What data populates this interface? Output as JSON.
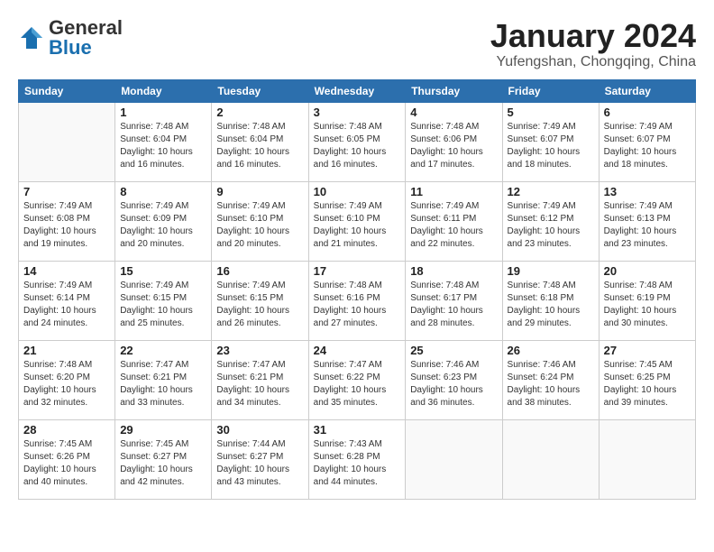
{
  "logo": {
    "general": "General",
    "blue": "Blue"
  },
  "header": {
    "month": "January 2024",
    "location": "Yufengshan, Chongqing, China"
  },
  "weekdays": [
    "Sunday",
    "Monday",
    "Tuesday",
    "Wednesday",
    "Thursday",
    "Friday",
    "Saturday"
  ],
  "weeks": [
    [
      {
        "day": "",
        "info": ""
      },
      {
        "day": "1",
        "info": "Sunrise: 7:48 AM\nSunset: 6:04 PM\nDaylight: 10 hours\nand 16 minutes."
      },
      {
        "day": "2",
        "info": "Sunrise: 7:48 AM\nSunset: 6:04 PM\nDaylight: 10 hours\nand 16 minutes."
      },
      {
        "day": "3",
        "info": "Sunrise: 7:48 AM\nSunset: 6:05 PM\nDaylight: 10 hours\nand 16 minutes."
      },
      {
        "day": "4",
        "info": "Sunrise: 7:48 AM\nSunset: 6:06 PM\nDaylight: 10 hours\nand 17 minutes."
      },
      {
        "day": "5",
        "info": "Sunrise: 7:49 AM\nSunset: 6:07 PM\nDaylight: 10 hours\nand 18 minutes."
      },
      {
        "day": "6",
        "info": "Sunrise: 7:49 AM\nSunset: 6:07 PM\nDaylight: 10 hours\nand 18 minutes."
      }
    ],
    [
      {
        "day": "7",
        "info": "Sunrise: 7:49 AM\nSunset: 6:08 PM\nDaylight: 10 hours\nand 19 minutes."
      },
      {
        "day": "8",
        "info": "Sunrise: 7:49 AM\nSunset: 6:09 PM\nDaylight: 10 hours\nand 20 minutes."
      },
      {
        "day": "9",
        "info": "Sunrise: 7:49 AM\nSunset: 6:10 PM\nDaylight: 10 hours\nand 20 minutes."
      },
      {
        "day": "10",
        "info": "Sunrise: 7:49 AM\nSunset: 6:10 PM\nDaylight: 10 hours\nand 21 minutes."
      },
      {
        "day": "11",
        "info": "Sunrise: 7:49 AM\nSunset: 6:11 PM\nDaylight: 10 hours\nand 22 minutes."
      },
      {
        "day": "12",
        "info": "Sunrise: 7:49 AM\nSunset: 6:12 PM\nDaylight: 10 hours\nand 23 minutes."
      },
      {
        "day": "13",
        "info": "Sunrise: 7:49 AM\nSunset: 6:13 PM\nDaylight: 10 hours\nand 23 minutes."
      }
    ],
    [
      {
        "day": "14",
        "info": "Sunrise: 7:49 AM\nSunset: 6:14 PM\nDaylight: 10 hours\nand 24 minutes."
      },
      {
        "day": "15",
        "info": "Sunrise: 7:49 AM\nSunset: 6:15 PM\nDaylight: 10 hours\nand 25 minutes."
      },
      {
        "day": "16",
        "info": "Sunrise: 7:49 AM\nSunset: 6:15 PM\nDaylight: 10 hours\nand 26 minutes."
      },
      {
        "day": "17",
        "info": "Sunrise: 7:48 AM\nSunset: 6:16 PM\nDaylight: 10 hours\nand 27 minutes."
      },
      {
        "day": "18",
        "info": "Sunrise: 7:48 AM\nSunset: 6:17 PM\nDaylight: 10 hours\nand 28 minutes."
      },
      {
        "day": "19",
        "info": "Sunrise: 7:48 AM\nSunset: 6:18 PM\nDaylight: 10 hours\nand 29 minutes."
      },
      {
        "day": "20",
        "info": "Sunrise: 7:48 AM\nSunset: 6:19 PM\nDaylight: 10 hours\nand 30 minutes."
      }
    ],
    [
      {
        "day": "21",
        "info": "Sunrise: 7:48 AM\nSunset: 6:20 PM\nDaylight: 10 hours\nand 32 minutes."
      },
      {
        "day": "22",
        "info": "Sunrise: 7:47 AM\nSunset: 6:21 PM\nDaylight: 10 hours\nand 33 minutes."
      },
      {
        "day": "23",
        "info": "Sunrise: 7:47 AM\nSunset: 6:21 PM\nDaylight: 10 hours\nand 34 minutes."
      },
      {
        "day": "24",
        "info": "Sunrise: 7:47 AM\nSunset: 6:22 PM\nDaylight: 10 hours\nand 35 minutes."
      },
      {
        "day": "25",
        "info": "Sunrise: 7:46 AM\nSunset: 6:23 PM\nDaylight: 10 hours\nand 36 minutes."
      },
      {
        "day": "26",
        "info": "Sunrise: 7:46 AM\nSunset: 6:24 PM\nDaylight: 10 hours\nand 38 minutes."
      },
      {
        "day": "27",
        "info": "Sunrise: 7:45 AM\nSunset: 6:25 PM\nDaylight: 10 hours\nand 39 minutes."
      }
    ],
    [
      {
        "day": "28",
        "info": "Sunrise: 7:45 AM\nSunset: 6:26 PM\nDaylight: 10 hours\nand 40 minutes."
      },
      {
        "day": "29",
        "info": "Sunrise: 7:45 AM\nSunset: 6:27 PM\nDaylight: 10 hours\nand 42 minutes."
      },
      {
        "day": "30",
        "info": "Sunrise: 7:44 AM\nSunset: 6:27 PM\nDaylight: 10 hours\nand 43 minutes."
      },
      {
        "day": "31",
        "info": "Sunrise: 7:43 AM\nSunset: 6:28 PM\nDaylight: 10 hours\nand 44 minutes."
      },
      {
        "day": "",
        "info": ""
      },
      {
        "day": "",
        "info": ""
      },
      {
        "day": "",
        "info": ""
      }
    ]
  ]
}
